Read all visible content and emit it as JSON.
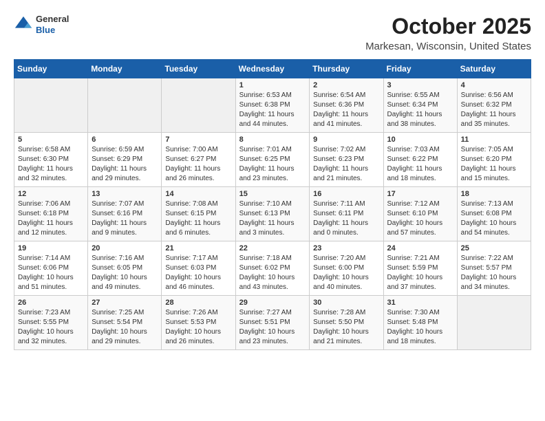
{
  "header": {
    "logo": {
      "general": "General",
      "blue": "Blue"
    },
    "title": "October 2025",
    "location": "Markesan, Wisconsin, United States"
  },
  "weekdays": [
    "Sunday",
    "Monday",
    "Tuesday",
    "Wednesday",
    "Thursday",
    "Friday",
    "Saturday"
  ],
  "weeks": [
    [
      {
        "day": "",
        "info": ""
      },
      {
        "day": "",
        "info": ""
      },
      {
        "day": "",
        "info": ""
      },
      {
        "day": "1",
        "info": "Sunrise: 6:53 AM\nSunset: 6:38 PM\nDaylight: 11 hours and 44 minutes."
      },
      {
        "day": "2",
        "info": "Sunrise: 6:54 AM\nSunset: 6:36 PM\nDaylight: 11 hours and 41 minutes."
      },
      {
        "day": "3",
        "info": "Sunrise: 6:55 AM\nSunset: 6:34 PM\nDaylight: 11 hours and 38 minutes."
      },
      {
        "day": "4",
        "info": "Sunrise: 6:56 AM\nSunset: 6:32 PM\nDaylight: 11 hours and 35 minutes."
      }
    ],
    [
      {
        "day": "5",
        "info": "Sunrise: 6:58 AM\nSunset: 6:30 PM\nDaylight: 11 hours and 32 minutes."
      },
      {
        "day": "6",
        "info": "Sunrise: 6:59 AM\nSunset: 6:29 PM\nDaylight: 11 hours and 29 minutes."
      },
      {
        "day": "7",
        "info": "Sunrise: 7:00 AM\nSunset: 6:27 PM\nDaylight: 11 hours and 26 minutes."
      },
      {
        "day": "8",
        "info": "Sunrise: 7:01 AM\nSunset: 6:25 PM\nDaylight: 11 hours and 23 minutes."
      },
      {
        "day": "9",
        "info": "Sunrise: 7:02 AM\nSunset: 6:23 PM\nDaylight: 11 hours and 21 minutes."
      },
      {
        "day": "10",
        "info": "Sunrise: 7:03 AM\nSunset: 6:22 PM\nDaylight: 11 hours and 18 minutes."
      },
      {
        "day": "11",
        "info": "Sunrise: 7:05 AM\nSunset: 6:20 PM\nDaylight: 11 hours and 15 minutes."
      }
    ],
    [
      {
        "day": "12",
        "info": "Sunrise: 7:06 AM\nSunset: 6:18 PM\nDaylight: 11 hours and 12 minutes."
      },
      {
        "day": "13",
        "info": "Sunrise: 7:07 AM\nSunset: 6:16 PM\nDaylight: 11 hours and 9 minutes."
      },
      {
        "day": "14",
        "info": "Sunrise: 7:08 AM\nSunset: 6:15 PM\nDaylight: 11 hours and 6 minutes."
      },
      {
        "day": "15",
        "info": "Sunrise: 7:10 AM\nSunset: 6:13 PM\nDaylight: 11 hours and 3 minutes."
      },
      {
        "day": "16",
        "info": "Sunrise: 7:11 AM\nSunset: 6:11 PM\nDaylight: 11 hours and 0 minutes."
      },
      {
        "day": "17",
        "info": "Sunrise: 7:12 AM\nSunset: 6:10 PM\nDaylight: 10 hours and 57 minutes."
      },
      {
        "day": "18",
        "info": "Sunrise: 7:13 AM\nSunset: 6:08 PM\nDaylight: 10 hours and 54 minutes."
      }
    ],
    [
      {
        "day": "19",
        "info": "Sunrise: 7:14 AM\nSunset: 6:06 PM\nDaylight: 10 hours and 51 minutes."
      },
      {
        "day": "20",
        "info": "Sunrise: 7:16 AM\nSunset: 6:05 PM\nDaylight: 10 hours and 49 minutes."
      },
      {
        "day": "21",
        "info": "Sunrise: 7:17 AM\nSunset: 6:03 PM\nDaylight: 10 hours and 46 minutes."
      },
      {
        "day": "22",
        "info": "Sunrise: 7:18 AM\nSunset: 6:02 PM\nDaylight: 10 hours and 43 minutes."
      },
      {
        "day": "23",
        "info": "Sunrise: 7:20 AM\nSunset: 6:00 PM\nDaylight: 10 hours and 40 minutes."
      },
      {
        "day": "24",
        "info": "Sunrise: 7:21 AM\nSunset: 5:59 PM\nDaylight: 10 hours and 37 minutes."
      },
      {
        "day": "25",
        "info": "Sunrise: 7:22 AM\nSunset: 5:57 PM\nDaylight: 10 hours and 34 minutes."
      }
    ],
    [
      {
        "day": "26",
        "info": "Sunrise: 7:23 AM\nSunset: 5:55 PM\nDaylight: 10 hours and 32 minutes."
      },
      {
        "day": "27",
        "info": "Sunrise: 7:25 AM\nSunset: 5:54 PM\nDaylight: 10 hours and 29 minutes."
      },
      {
        "day": "28",
        "info": "Sunrise: 7:26 AM\nSunset: 5:53 PM\nDaylight: 10 hours and 26 minutes."
      },
      {
        "day": "29",
        "info": "Sunrise: 7:27 AM\nSunset: 5:51 PM\nDaylight: 10 hours and 23 minutes."
      },
      {
        "day": "30",
        "info": "Sunrise: 7:28 AM\nSunset: 5:50 PM\nDaylight: 10 hours and 21 minutes."
      },
      {
        "day": "31",
        "info": "Sunrise: 7:30 AM\nSunset: 5:48 PM\nDaylight: 10 hours and 18 minutes."
      },
      {
        "day": "",
        "info": ""
      }
    ]
  ]
}
